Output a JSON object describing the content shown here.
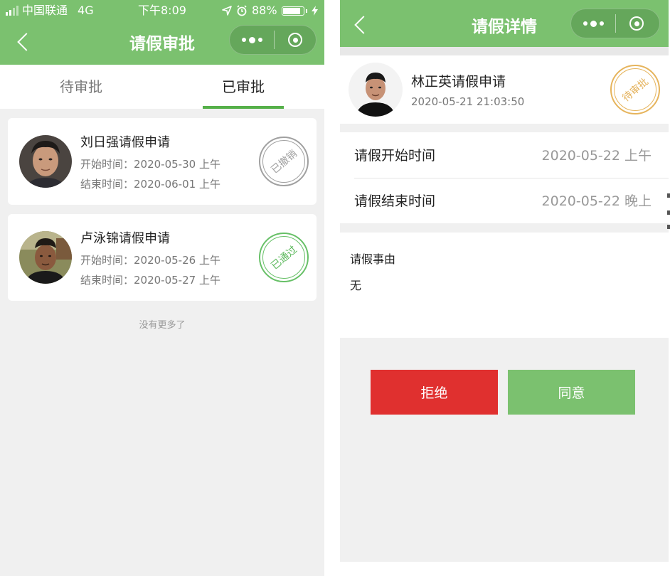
{
  "status_bar": {
    "carrier": "中国联通",
    "network": "4G",
    "time": "下午8:09",
    "battery": "88%",
    "battery_level": 0.88
  },
  "list_page": {
    "title": "请假审批",
    "tabs": [
      {
        "label": "待审批",
        "active": false
      },
      {
        "label": "已审批",
        "active": true
      }
    ],
    "cards": [
      {
        "title": "刘日强请假申请",
        "start": "开始时间：2020-05-30 上午",
        "end": "结束时间：2020-06-01 上午",
        "stamp": "已撤销",
        "stamp_color": "#9e9e9e"
      },
      {
        "title": "卢泳锦请假申请",
        "start": "开始时间：2020-05-26 上午",
        "end": "结束时间：2020-05-27 上午",
        "stamp": "已通过",
        "stamp_color": "#5cb85c"
      }
    ],
    "footer": "没有更多了"
  },
  "detail_page": {
    "title": "请假详情",
    "applicant": {
      "title": "林正英请假申请",
      "submitted": "2020-05-21 21:03:50",
      "stamp": "待审批",
      "stamp_color": "#e4b15a"
    },
    "start_label": "请假开始时间",
    "start_value": "2020-05-22 上午",
    "end_label": "请假结束时间",
    "end_value": "2020-05-22 晚上",
    "reason_label": "请假事由",
    "reason_value": "无",
    "reject_label": "拒绝",
    "approve_label": "同意"
  },
  "colors": {
    "header_green": "#7bc16f",
    "tab_underline": "#55b049",
    "reject": "#e0302f",
    "approve": "#7bc16f"
  },
  "icons": [
    "signal-icon",
    "location-icon",
    "alarm-icon",
    "battery-icon",
    "charging-icon",
    "back-chevron-icon",
    "more-dots-icon",
    "target-circle-icon"
  ]
}
